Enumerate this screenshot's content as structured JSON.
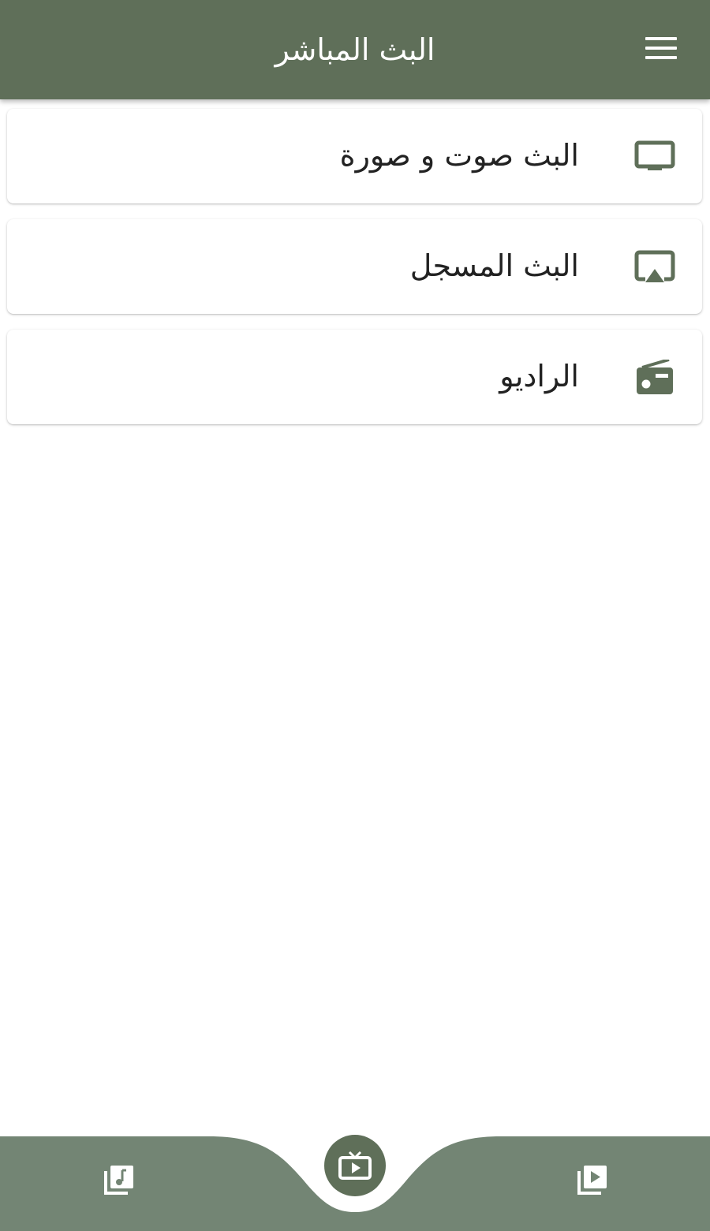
{
  "header": {
    "title": "البث المباشر",
    "menu_icon": "hamburger-menu-icon"
  },
  "items": [
    {
      "label": "البث صوت و صورة",
      "icon": "tv-icon"
    },
    {
      "label": "البث المسجل",
      "icon": "airplay-icon"
    },
    {
      "label": "الراديو",
      "icon": "radio-icon"
    }
  ],
  "bottom_nav": {
    "left_icon": "music-library-icon",
    "center_icon": "live-tv-icon",
    "right_icon": "video-library-icon"
  },
  "colors": {
    "header_bg": "#5f6f59",
    "nav_bg": "#738574",
    "icon_color": "#5f6f59",
    "text": "#222222"
  }
}
